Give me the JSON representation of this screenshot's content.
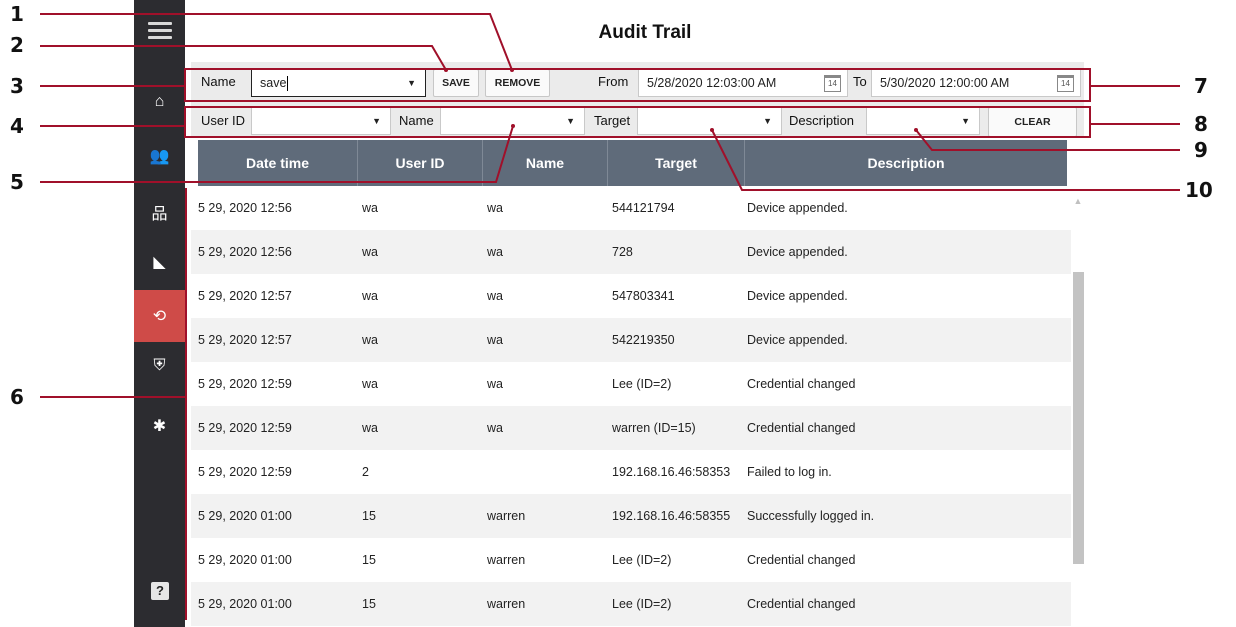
{
  "title": "Audit Trail",
  "sidebar": {
    "items": [
      {
        "icon": "home-icon",
        "glyph": "⌂"
      },
      {
        "icon": "users-icon",
        "glyph": "👥"
      },
      {
        "icon": "network-icon",
        "glyph": "品"
      },
      {
        "icon": "camera-icon",
        "glyph": "◣"
      },
      {
        "icon": "history-icon",
        "glyph": "⟲",
        "active": true
      },
      {
        "icon": "shield-icon",
        "glyph": "⛨"
      },
      {
        "icon": "gear-icon",
        "glyph": "✱"
      }
    ],
    "help_glyph": "?"
  },
  "filters": {
    "name_label": "Name",
    "name_value": "save",
    "save_label": "SAVE",
    "remove_label": "REMOVE",
    "from_label": "From",
    "from_value": "5/28/2020 12:03:00 AM",
    "to_label": "To",
    "to_value": "5/30/2020 12:00:00 AM",
    "calendar_glyph": "14",
    "userid_label": "User ID",
    "userid_value": "",
    "name2_label": "Name",
    "name2_value": "",
    "target_label": "Target",
    "target_value": "",
    "description_label": "Description",
    "description_value": "",
    "clear_label": "CLEAR",
    "caret": "▼"
  },
  "table": {
    "columns": [
      "Date time",
      "User ID",
      "Name",
      "Target",
      "Description"
    ],
    "rows": [
      [
        "5 29, 2020 12:56",
        "wa",
        "wa",
        "544121794",
        "Device appended."
      ],
      [
        "5 29, 2020 12:56",
        "wa",
        "wa",
        "728",
        "Device appended."
      ],
      [
        "5 29, 2020 12:57",
        "wa",
        "wa",
        "547803341",
        "Device appended."
      ],
      [
        "5 29, 2020 12:57",
        "wa",
        "wa",
        "542219350",
        "Device appended."
      ],
      [
        "5 29, 2020 12:59",
        "wa",
        "wa",
        "Lee  (ID=2)",
        "Credential changed"
      ],
      [
        "5 29, 2020 12:59",
        "wa",
        "wa",
        "warren  (ID=15)",
        "Credential changed"
      ],
      [
        "5 29, 2020 12:59",
        "2",
        "",
        "192.168.16.46:58353",
        "Failed to log in."
      ],
      [
        "5 29, 2020 01:00",
        "15",
        "warren",
        "192.168.16.46:58355",
        "Successfully logged in."
      ],
      [
        "5 29, 2020 01:00",
        "15",
        "warren",
        "Lee  (ID=2)",
        "Credential changed"
      ],
      [
        "5 29, 2020 01:00",
        "15",
        "warren",
        "Lee  (ID=2)",
        "Credential changed"
      ]
    ]
  },
  "callouts": [
    "1",
    "2",
    "3",
    "4",
    "5",
    "6",
    "7",
    "8",
    "9",
    "10"
  ],
  "colors": {
    "accent": "#cf4b48",
    "callout_line": "#a0102a",
    "header": "#5f6b7a",
    "sidebar": "#2c2c30"
  }
}
